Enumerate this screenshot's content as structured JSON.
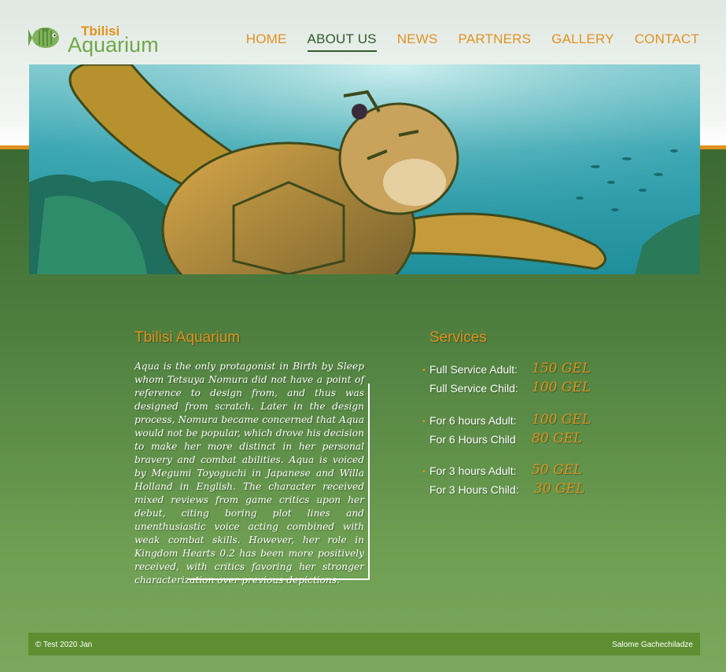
{
  "brand": {
    "line1": "Tbilisi",
    "line2": "Aquarium"
  },
  "nav": [
    {
      "label": "HOME",
      "active": false
    },
    {
      "label": "ABOUT US",
      "active": true
    },
    {
      "label": "NEWS",
      "active": false
    },
    {
      "label": "PARTNERS",
      "active": false
    },
    {
      "label": "GALLERY",
      "active": false
    },
    {
      "label": "CONTACT",
      "active": false
    }
  ],
  "hero": {
    "image": "sea-turtle-underwater"
  },
  "about": {
    "title": "Tbilisi Aquarium",
    "text": "Aqua is the only protagonist in Birth by Sleep whom Tetsuya Nomura did not have a point of reference to design from, and thus was designed from scratch. Later in the design process, Nomura became concerned that Aqua would not be popular, which drove his decision to make her more distinct in her personal bravery and combat abilities. Aqua is voiced by Megumi Toyoguchi in Japanese and Willa Holland in English. The character received mixed reviews from game critics upon her debut, citing boring plot lines and unenthusiastic voice acting combined with weak combat skills. However, her role in Kingdom Hearts 0.2 has been more positively received, with critics favoring her stronger characterization over previous depictions."
  },
  "services": {
    "title": "Services",
    "groups": [
      {
        "items": [
          {
            "label": "Full Service Adult:",
            "price": "150 GEL"
          },
          {
            "label": "Full Service Child:",
            "price": "100 GEL"
          }
        ]
      },
      {
        "items": [
          {
            "label": "For 6 hours Adult:",
            "price": "100 GEL"
          },
          {
            "label": "For 6 Hours Child",
            "price": "80 GEL"
          }
        ]
      },
      {
        "items": [
          {
            "label": "For 3 hours Adult:",
            "price": "50 GEL"
          },
          {
            "label": "For 3 Hours Child:",
            "price": "30 GEL"
          }
        ]
      }
    ]
  },
  "footer": {
    "copyright": "© Test 2020 Jan",
    "author": "Salome Gachechiladze"
  },
  "colors": {
    "accent": "#e0921f",
    "green_dark": "#3c6a33",
    "nav_active": "#2f5a2a",
    "footer_bg": "#5d8f32"
  }
}
